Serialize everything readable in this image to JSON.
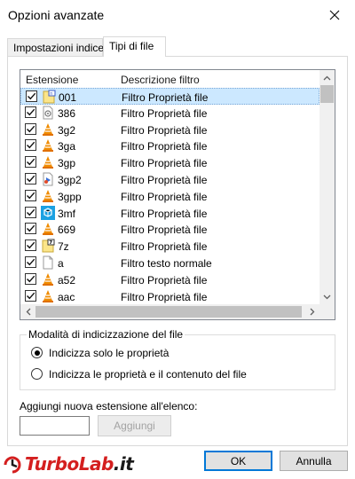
{
  "window": {
    "title": "Opzioni avanzate"
  },
  "tabs": [
    {
      "label": "Impostazioni indice",
      "active": false
    },
    {
      "label": "Tipi di file",
      "active": true
    }
  ],
  "list": {
    "columns": {
      "extension": "Estensione",
      "description": "Descrizione filtro"
    },
    "rows": [
      {
        "ext": "001",
        "desc": "Filtro Proprietà file",
        "checked": true,
        "icon": "generic-file-icon",
        "selected": true
      },
      {
        "ext": "386",
        "desc": "Filtro Proprietà file",
        "checked": true,
        "icon": "system-file-icon"
      },
      {
        "ext": "3g2",
        "desc": "Filtro Proprietà file",
        "checked": true,
        "icon": "vlc-cone-icon"
      },
      {
        "ext": "3ga",
        "desc": "Filtro Proprietà file",
        "checked": true,
        "icon": "vlc-cone-icon"
      },
      {
        "ext": "3gp",
        "desc": "Filtro Proprietà file",
        "checked": true,
        "icon": "vlc-cone-icon"
      },
      {
        "ext": "3gp2",
        "desc": "Filtro Proprietà file",
        "checked": true,
        "icon": "media-file-icon"
      },
      {
        "ext": "3gpp",
        "desc": "Filtro Proprietà file",
        "checked": true,
        "icon": "vlc-cone-icon"
      },
      {
        "ext": "3mf",
        "desc": "Filtro Proprietà file",
        "checked": true,
        "icon": "3d-builder-icon"
      },
      {
        "ext": "669",
        "desc": "Filtro Proprietà file",
        "checked": true,
        "icon": "vlc-cone-icon"
      },
      {
        "ext": "7z",
        "desc": "Filtro Proprietà file",
        "checked": true,
        "icon": "archive-7z-icon"
      },
      {
        "ext": "a",
        "desc": "Filtro testo normale",
        "checked": true,
        "icon": "blank-file-icon"
      },
      {
        "ext": "a52",
        "desc": "Filtro Proprietà file",
        "checked": true,
        "icon": "vlc-cone-icon"
      },
      {
        "ext": "aac",
        "desc": "Filtro Proprietà file",
        "checked": true,
        "icon": "vlc-cone-icon"
      }
    ]
  },
  "indexing": {
    "group_title": "Modalità di indicizzazione del file",
    "options": [
      {
        "label": "Indicizza solo le proprietà",
        "selected": true
      },
      {
        "label": "Indicizza le proprietà e il contenuto del file",
        "selected": false
      }
    ]
  },
  "add_extension": {
    "label": "Aggiungi nuova estensione all'elenco:",
    "value": "",
    "button_label": "Aggiungi"
  },
  "buttons": {
    "ok": "OK",
    "cancel": "Annulla"
  },
  "watermark": {
    "brand": "TurboLab",
    "suffix": ".it"
  },
  "colors": {
    "accent": "#0078d7",
    "selection": "#cce8ff",
    "vlc_orange": "#f08c00",
    "watermark_red": "#d41f1f"
  }
}
